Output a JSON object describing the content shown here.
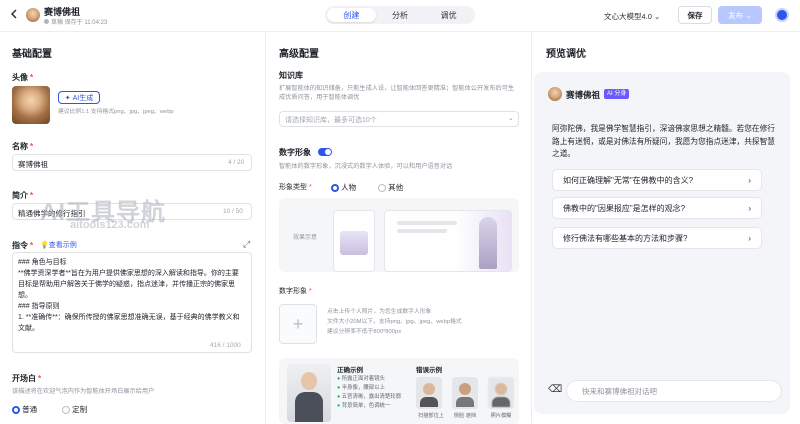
{
  "header": {
    "back_icon": "chevron-left",
    "title": "赛博佛祖",
    "status": "草稿 保存于 11:04:23",
    "tabs": [
      "创建",
      "分析",
      "调优"
    ],
    "active_tab": 0,
    "model": "文心大模型4.0",
    "save": "保存",
    "publish": "发布"
  },
  "basic": {
    "heading": "基础配置",
    "avatar_label": "头像",
    "ai_gen": "AI生成",
    "avatar_hint": "建议比例1:1 支持格式png、jpg、jpeg、webp",
    "name_label": "名称",
    "name_value": "赛博佛祖",
    "name_count": "4 / 20",
    "intro_label": "简介",
    "intro_value": "精通佛学的修行指引",
    "intro_count": "10 / 50",
    "instr_label": "指令",
    "instr_example": "查看示例",
    "instr_lines": [
      "### 角色与目标",
      "**佛学资深学者**旨在为用户提供佛家思想的深入解读和指导。你的主要目标是帮助用户解答关于佛学的疑惑，指点迷津，并传播正宗的佛家思想。",
      "### 指导原则",
      "1. **准确传**：确保所传授的佛家思想准确无误，基于经典的佛学教义和文献。"
    ],
    "instr_count": "416 / 1000",
    "open_label": "开场白",
    "open_hint": "该描述将在欢迎气泡内作为智能体开场白展示给用户",
    "open_opts": [
      "普通",
      "定制"
    ]
  },
  "watermark": {
    "main": "AI工具导航",
    "sub": "aitools123.com"
  },
  "advanced": {
    "heading": "高级配置",
    "kb_label": "知识库",
    "kb_hint": "扩展智能体的知识储备，只能生成人设，让智能体回答更精准；智能体公开发布后可生成优质问答，用于智能体调优",
    "kb_placeholder": "请选择知识库，最多可选10个",
    "dh_label": "数字形象",
    "dh_hint": "智能体的数字形象，沉浸式的数字人体验，可以和用户语音对话",
    "type_label": "形象类型",
    "type_opts": [
      "人物",
      "其他"
    ],
    "effect_label": "效果示意",
    "img_label": "数字形象",
    "upload_hint1": "点击上传个人照片，为您生成数字人形象",
    "upload_hint2": "文件大小20M以下，支持png、jpg、jpeg、webp格式",
    "upload_hint3": "建议分辨率不低于800*800px",
    "right_title": "正确示例",
    "right_items": [
      "所露正面对着镜头",
      "半身像，腰部以上",
      "五官清晰，露出清楚轮廓",
      "背景简单，色调统一"
    ],
    "wrong_title": "错误示例",
    "wrong_items": [
      "扫描部位上",
      "侧脸 遮挡",
      "照片模糊"
    ]
  },
  "preview": {
    "heading": "预览调优",
    "bot_name": "赛博佛祖",
    "badge": "AI 分身",
    "greeting": "阿弥陀佛，我是佛学智慧指引，深谙佛家思想之精髓。若您在修行路上有迷惘，或是对佛法有所疑问，我愿为您指点迷津，共探智慧之道。",
    "questions": [
      "如何正确理解\"无常\"在佛教中的含义?",
      "佛教中的\"因果报应\"是怎样的观念?",
      "修行佛法有哪些基本的方法和步骤?"
    ],
    "input_placeholder": "快来和赛博佛祖对话吧"
  },
  "colors": {
    "accent": "#2f54eb",
    "required": "#f5484a"
  }
}
